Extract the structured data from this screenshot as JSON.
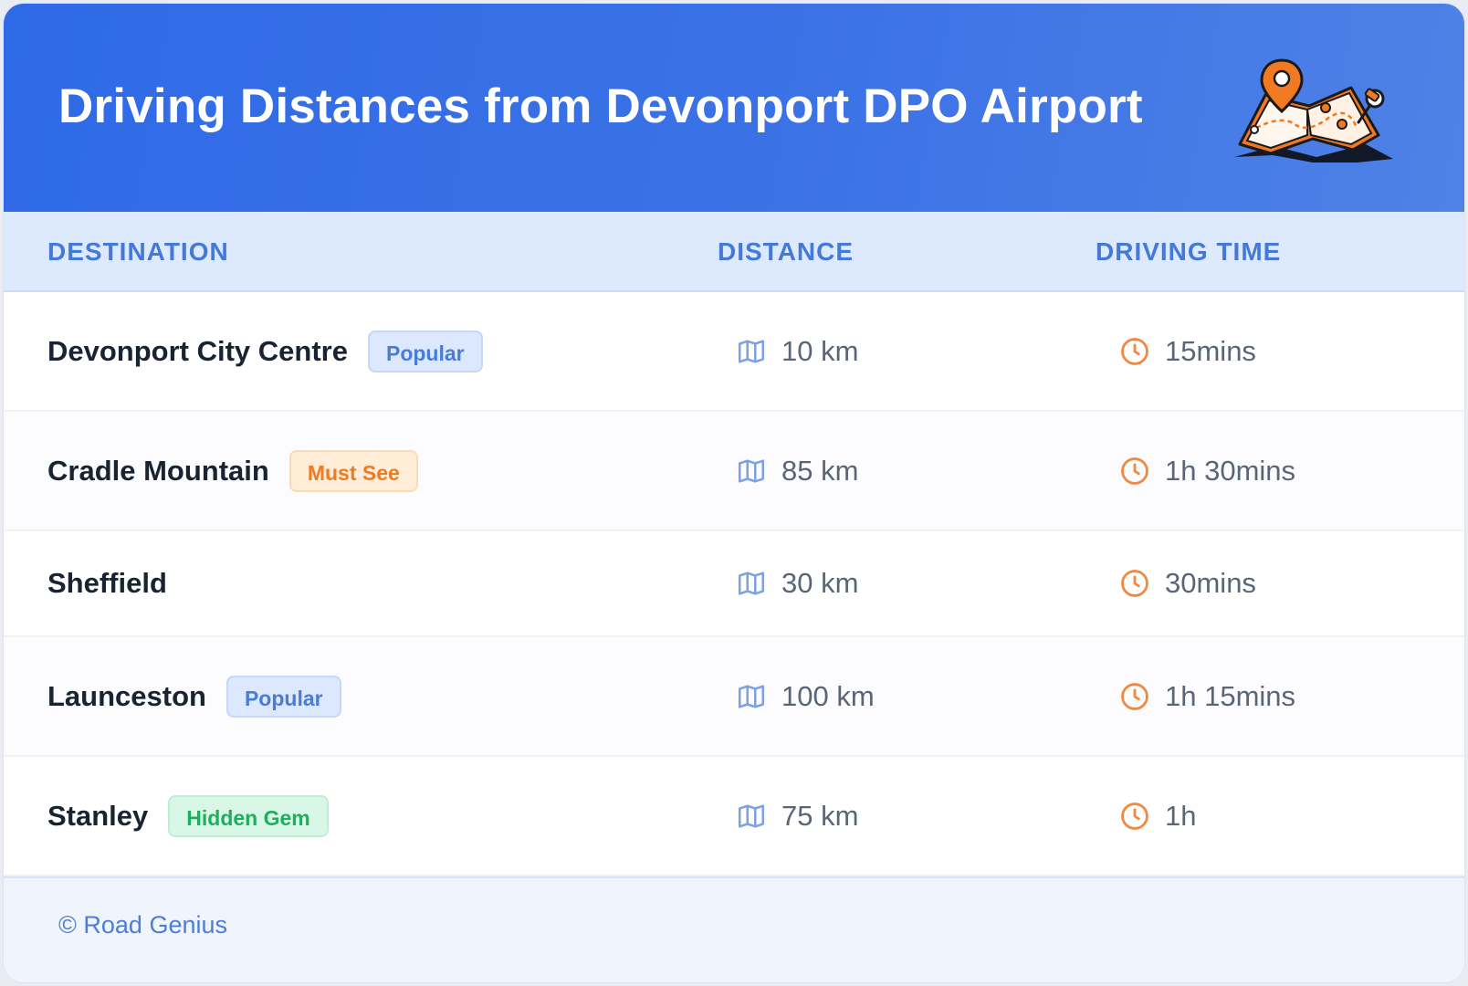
{
  "header": {
    "title": "Driving Distances from Devonport DPO Airport",
    "illustration_icon": "map-pin-illustration-icon"
  },
  "columns": {
    "destination": "DESTINATION",
    "distance": "DISTANCE",
    "driving_time": "DRIVING TIME"
  },
  "rows": [
    {
      "destination": "Devonport City Centre",
      "badge": "Popular",
      "badge_type": "popular",
      "distance": "10 km",
      "time": "15mins"
    },
    {
      "destination": "Cradle Mountain",
      "badge": "Must See",
      "badge_type": "mustsee",
      "distance": "85 km",
      "time": "1h 30mins"
    },
    {
      "destination": "Sheffield",
      "badge": "",
      "badge_type": "",
      "distance": "30 km",
      "time": "30mins"
    },
    {
      "destination": "Launceston",
      "badge": "Popular",
      "badge_type": "popular",
      "distance": "100 km",
      "time": "1h 15mins"
    },
    {
      "destination": "Stanley",
      "badge": "Hidden Gem",
      "badge_type": "hidden",
      "distance": "75 km",
      "time": "1h"
    }
  ],
  "icons": {
    "distance": "map-icon",
    "time": "clock-icon"
  },
  "colors": {
    "header_start": "#2f6ae6",
    "header_end": "#4f82e6",
    "accent_blue": "#4479d9",
    "accent_orange": "#ee7b22",
    "accent_green": "#1fae5d"
  },
  "footer": {
    "text": "© Road Genius"
  }
}
